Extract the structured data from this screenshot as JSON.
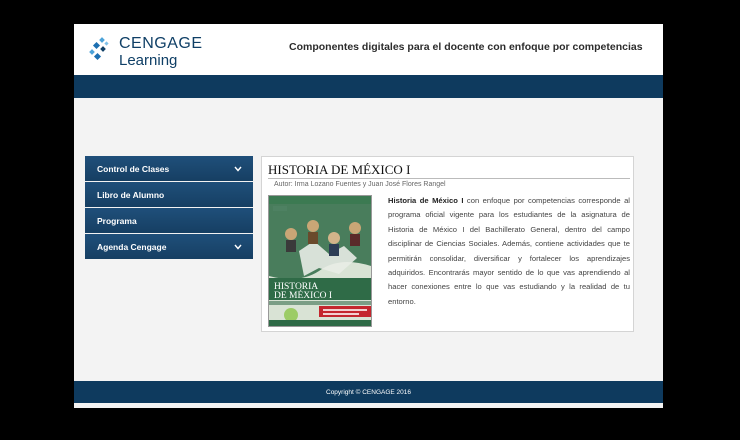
{
  "brand": {
    "line1": "CENGAGE",
    "line2": "Learning"
  },
  "header": {
    "tagline": "Componentes digitales para el docente con enfoque por competencias"
  },
  "sidebar": {
    "items": [
      {
        "label": "Control de Clases",
        "has_chevron": true
      },
      {
        "label": "Libro de Alumno",
        "has_chevron": false
      },
      {
        "label": "Programa",
        "has_chevron": false
      },
      {
        "label": "Agenda Cengage",
        "has_chevron": true
      }
    ]
  },
  "book": {
    "title": "HISTORIA DE MÉXICO I",
    "author": "Autor: Irma Lozano Fuentes y Juan José Flores Rangel",
    "desc_strong": "Historia de México I",
    "desc_rest": " con enfoque por competencias corresponde al programa oficial vigente para los estudiantes de la asignatura de Historia de México I del Bachillerato General, dentro del campo disciplinar de Ciencias Sociales. Además, contiene actividades que te permitirán consolidar, diversificar y fortalecer los aprendizajes adquiridos. Encontrarás mayor sentido de lo que vas aprendiendo al hacer conexiones entre lo que vas estudiando y la realidad de tu entorno.",
    "cover_title_1": "HISTORIA",
    "cover_title_2": "DE MÉXICO I"
  },
  "footer": {
    "copyright": "Copyright © CENGAGE 2016"
  },
  "colors": {
    "navy": "#0e3a5e",
    "nav": "#1a4670",
    "cover_green": "#2f6b47",
    "cover_red": "#c4262e"
  }
}
